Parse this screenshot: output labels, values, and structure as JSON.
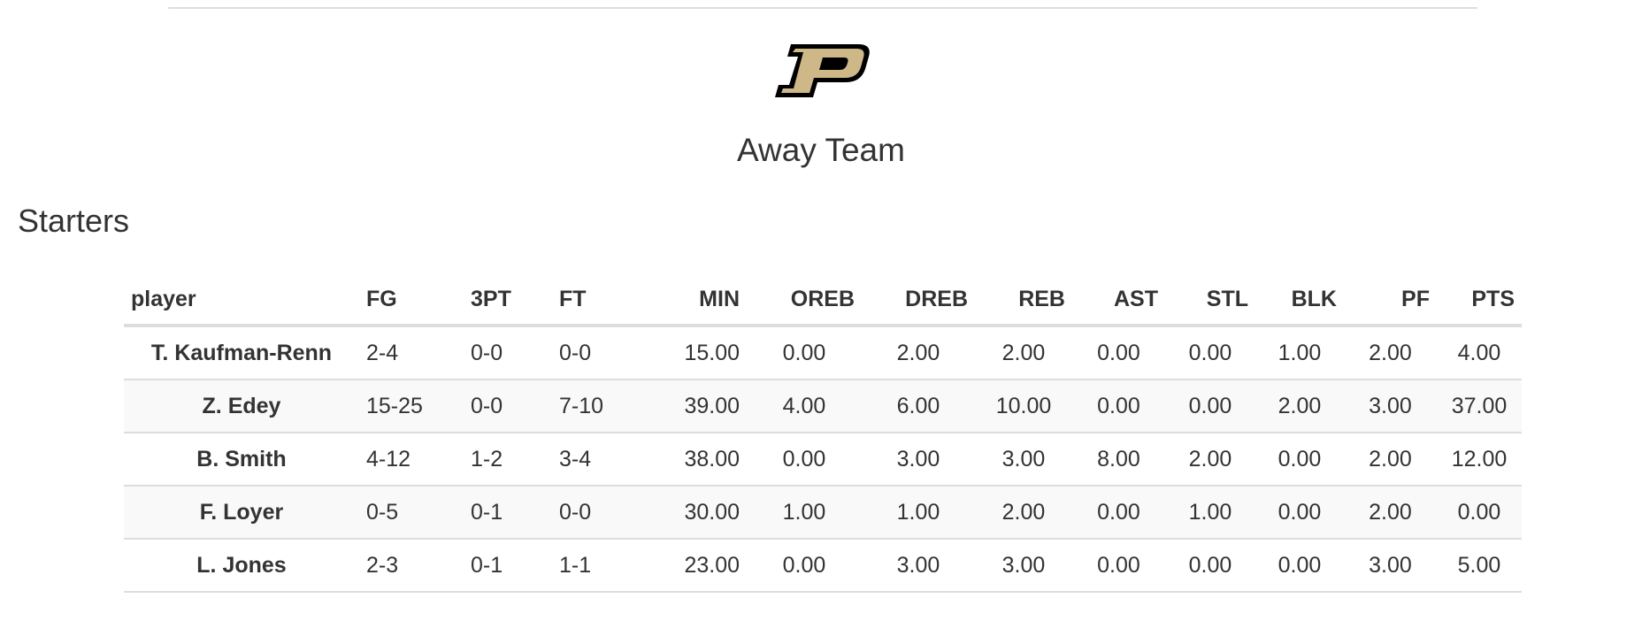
{
  "header": {
    "team_title": "Away Team",
    "logo_icon": "purdue-p-logo-icon",
    "logo_colors": {
      "fill": "#CEB888",
      "outline": "#000000"
    }
  },
  "section": {
    "title": "Starters"
  },
  "table": {
    "columns": [
      "player",
      "FG",
      "3PT",
      "FT",
      "MIN",
      "OREB",
      "DREB",
      "REB",
      "AST",
      "STL",
      "BLK",
      "PF",
      "PTS"
    ],
    "rows": [
      [
        "T. Kaufman-Renn",
        "2-4",
        "0-0",
        "0-0",
        "15.00",
        "0.00",
        "2.00",
        "2.00",
        "0.00",
        "0.00",
        "1.00",
        "2.00",
        "4.00"
      ],
      [
        "Z. Edey",
        "15-25",
        "0-0",
        "7-10",
        "39.00",
        "4.00",
        "6.00",
        "10.00",
        "0.00",
        "0.00",
        "2.00",
        "3.00",
        "37.00"
      ],
      [
        "B. Smith",
        "4-12",
        "1-2",
        "3-4",
        "38.00",
        "0.00",
        "3.00",
        "3.00",
        "8.00",
        "2.00",
        "0.00",
        "2.00",
        "12.00"
      ],
      [
        "F. Loyer",
        "0-5",
        "0-1",
        "0-0",
        "30.00",
        "1.00",
        "1.00",
        "2.00",
        "0.00",
        "1.00",
        "0.00",
        "2.00",
        "0.00"
      ],
      [
        "L. Jones",
        "2-3",
        "0-1",
        "1-1",
        "23.00",
        "0.00",
        "3.00",
        "3.00",
        "0.00",
        "0.00",
        "0.00",
        "3.00",
        "5.00"
      ]
    ]
  }
}
